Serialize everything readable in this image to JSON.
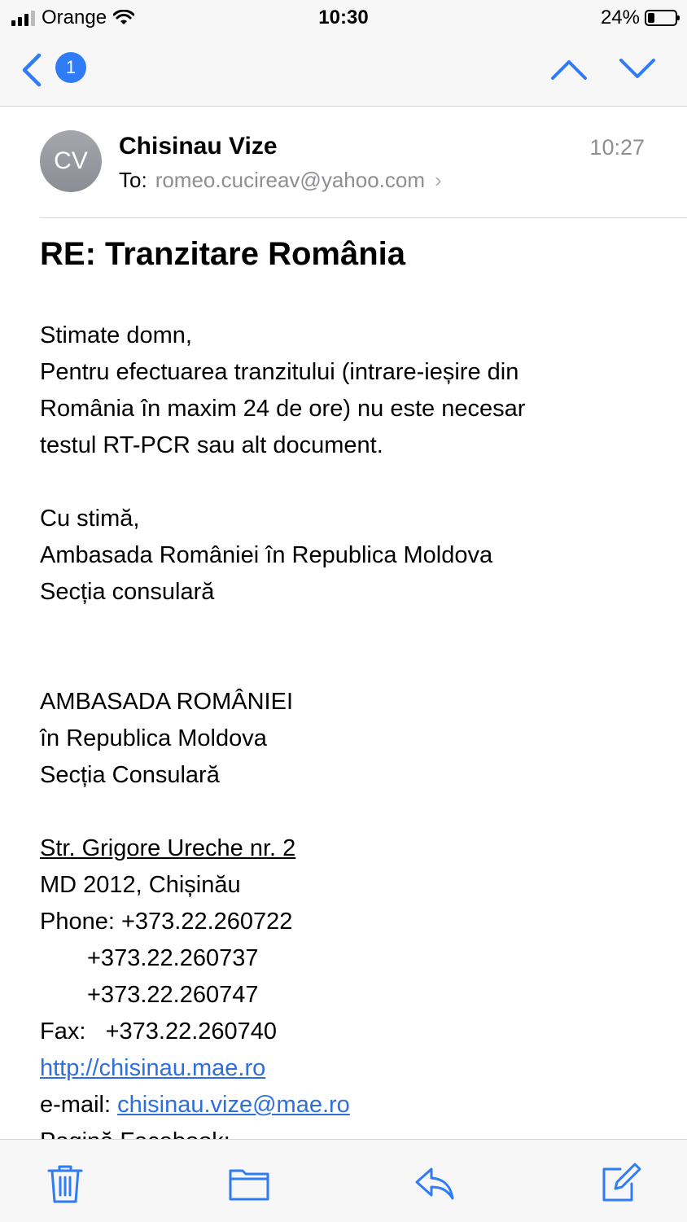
{
  "status_bar": {
    "carrier": "Orange",
    "time": "10:30",
    "battery_percent": "24%",
    "battery_level": 0.24,
    "icons": [
      "signal-icon",
      "wifi-icon",
      "battery-icon"
    ]
  },
  "nav": {
    "unread_count": "1",
    "icons": [
      "back-chevron-icon",
      "previous-message-icon",
      "next-message-icon"
    ],
    "accent_color": "#2f7cf6"
  },
  "message": {
    "avatar_initials": "CV",
    "sender": "Chisinau Vize",
    "time": "10:27",
    "to_label": "To:",
    "to_address": "romeo.cucireav@yahoo.com",
    "subject": "RE: Tranzitare România",
    "body": {
      "greeting": "Stimate domn,",
      "lines": [
        "Pentru efectuarea tranzitului (intrare-ieșire din",
        "România în maxim 24 de ore) nu este necesar",
        "testul RT-PCR sau alt document."
      ],
      "closing": "Cu stimă,",
      "sign1": "Ambasada României în Republica Moldova",
      "sign2": "Secția consulară"
    },
    "signature": {
      "org1": "AMBASADA ROMÂNIEI",
      "org2": "în Republica Moldova",
      "org3": "Secția Consulară",
      "street": "Str. Grigore Ureche nr. 2",
      "city": "MD 2012, Chișinău",
      "phone1": "Phone: +373.22.260722",
      "phone2": "+373.22.260737",
      "phone3": "+373.22.260747",
      "fax": "Fax:   +373.22.260740",
      "website": "http://chisinau.mae.ro",
      "email_label": "e-mail: ",
      "email": "chisinau.vize@mae.ro",
      "facebook_partial": "Pagină Facebook:"
    }
  },
  "toolbar": {
    "icons": [
      "trash-icon",
      "folder-icon",
      "reply-icon",
      "compose-icon"
    ],
    "icon_color": "#2f7cf6"
  }
}
